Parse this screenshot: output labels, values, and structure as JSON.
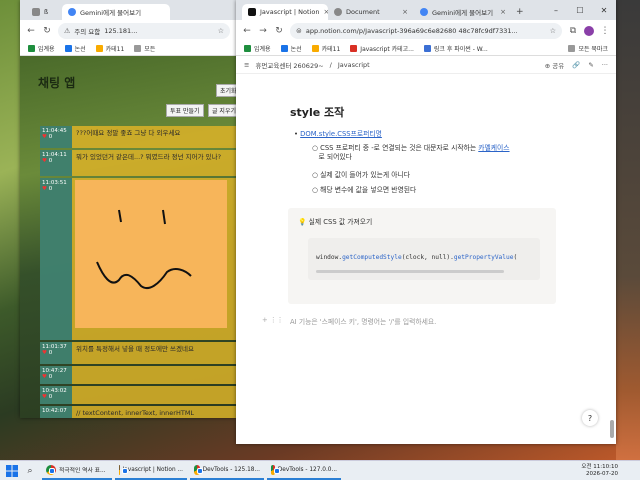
{
  "left_window": {
    "tabs": [
      {
        "label": "ß"
      },
      {
        "label": "Gemini에게 물어보기"
      }
    ],
    "url": "125.181...",
    "security_label": "주의 요함",
    "bookmarks": [
      {
        "label": "입계용"
      },
      {
        "label": "논선"
      },
      {
        "label": "카테11"
      },
      {
        "label": "모든"
      }
    ],
    "page": {
      "title": "채팅 앱",
      "top_button": "초기화",
      "buttons": [
        "투표 만들기",
        "글 지우기"
      ],
      "messages": [
        {
          "time": "11:04:45",
          "count": "0",
          "text": "???어때요 정말 좋죠 그냥 다 외우세요"
        },
        {
          "time": "11:04:11",
          "count": "0",
          "text": "뭐가 있었던거 같은데...? 뭐였드라 정넌 지어가 있나?"
        },
        {
          "time": "11:03:51",
          "count": "0",
          "text": ""
        },
        {
          "time": "11:01:37",
          "count": "0",
          "text": "위치를 특정해서 넣을 때 정도에만 쓰겠네요"
        },
        {
          "time": "10:47:27",
          "count": "0",
          "text": ""
        },
        {
          "time": "10:43:02",
          "count": "0",
          "text": ""
        },
        {
          "time": "10:42:07",
          "count": "",
          "text": "// textContent, innerText, innerHTML"
        }
      ]
    }
  },
  "right_window": {
    "tabs": [
      {
        "label": "Javascript | Notion"
      },
      {
        "label": "Document"
      },
      {
        "label": "Gemini에게 물어보기"
      }
    ],
    "url": "app.notion.com/p/Javascript-396a69c6e82680 48c78fc9df7331...",
    "bookmarks": [
      {
        "label": "입계용"
      },
      {
        "label": "논선"
      },
      {
        "label": "카테11"
      },
      {
        "label": "Javascript 카테고..."
      },
      {
        "label": "링크 후 파이썬 - W..."
      },
      {
        "label": "모든 북마크"
      }
    ],
    "breadcrumb": [
      "휴먼교육센터 260629~",
      "Javascript"
    ],
    "share_label": "공유",
    "heading": "style 조작",
    "bullet": "DOM.style.CSS프로퍼티명",
    "subbullets": [
      "CSS 프로퍼티 중 -로 연결되는 것은 대문자로 시작하는",
      "카멜케이스",
      "로 되어있다",
      "실제 값이 들어가 있는게 아니다",
      "해당 변수에 값을 넣으면 반영된다"
    ],
    "callout_title": "실제 CSS 값 가져오기",
    "code_prefix": "window.",
    "code_fn1": "getComputedStyle",
    "code_mid": "(clock, null).",
    "code_fn2": "getPropertyValue",
    "code_suffix": "(",
    "placeholder": "AI 기능은 '스페이스 키', 명령어는 '/'를 입력하세요."
  },
  "taskbar": {
    "items": [
      {
        "label": "적극적인 역사 표..."
      },
      {
        "label": "Javascript | Notion ..."
      },
      {
        "label": "DevTools - 125.18..."
      },
      {
        "label": "DevTools - 127.0.0..."
      }
    ],
    "time": "오전 11:10:10",
    "date": "2026-07-20"
  }
}
